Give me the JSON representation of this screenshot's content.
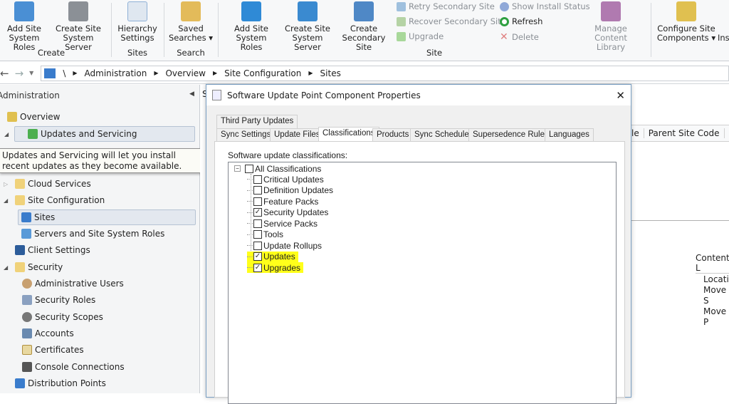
{
  "ribbon": {
    "buttons": [
      {
        "label1": "Add Site",
        "label2": "System Roles",
        "color": "#4a8fd4"
      },
      {
        "label1": "Create Site",
        "label2": "System Server",
        "color": "#8b9096"
      },
      {
        "label1": "Hierarchy",
        "label2": "Settings",
        "color": "#8fb0d6"
      },
      {
        "label1": "Saved",
        "label2": "Searches ▾",
        "color": "#e3bb5a"
      },
      {
        "label1": "Add Site",
        "label2": "System Roles",
        "color": "#2f8ad6"
      },
      {
        "label1": "Create Site",
        "label2": "System Server",
        "color": "#3a8ad0"
      },
      {
        "label1": "Create",
        "label2": "Secondary Site",
        "color": "#4f88c6"
      },
      {
        "label1": "Manage",
        "label2": "Content Library",
        "color": "#b07ab0"
      },
      {
        "label1": "Configure Site",
        "label2": "Components ▾",
        "color": "#e0c050"
      },
      {
        "label1": "Ins",
        "label2": ""
      }
    ],
    "small_buttons": [
      {
        "label": "Retry Secondary Site",
        "enabled": false
      },
      {
        "label": "Recover Secondary Site",
        "enabled": false
      },
      {
        "label": "Upgrade",
        "enabled": false
      },
      {
        "label": "Show Install Status",
        "enabled": false
      },
      {
        "label": "Refresh",
        "enabled": true
      },
      {
        "label": "Delete",
        "enabled": false
      }
    ],
    "groups": [
      "Create",
      "Sites",
      "Search",
      "Site"
    ]
  },
  "nav": {
    "breadcrumb": [
      "\\",
      "Administration",
      "Overview",
      "Site Configuration",
      "Sites"
    ]
  },
  "sidebar": {
    "title": "Administration",
    "items": [
      {
        "label": "Overview"
      },
      {
        "label": "Updates and Servicing"
      },
      {
        "label": "Cloud Services"
      },
      {
        "label": "Site Configuration"
      },
      {
        "label": "Sites"
      },
      {
        "label": "Servers and Site System Roles"
      },
      {
        "label": "Client Settings"
      },
      {
        "label": "Security"
      },
      {
        "label": "Administrative Users"
      },
      {
        "label": "Security Roles"
      },
      {
        "label": "Security Scopes"
      },
      {
        "label": "Accounts"
      },
      {
        "label": "Certificates"
      },
      {
        "label": "Console Connections"
      },
      {
        "label": "Distribution Points"
      }
    ],
    "tooltip": "Updates and Servicing will let you install recent updates as they become available."
  },
  "main": {
    "column_partial": "le",
    "column": "Parent Site Code",
    "section": "Content L",
    "details": [
      "Locatio",
      "Move S",
      "Move P"
    ],
    "pane_letter": "S"
  },
  "dialog": {
    "title": "Software Update Point Component Properties",
    "tabs_row1": [
      "Third Party Updates"
    ],
    "tabs_row2": [
      "Sync Settings",
      "Update Files",
      "Classifications",
      "Products",
      "Sync Schedule",
      "Supersedence Rules",
      "Languages"
    ],
    "active_tab": "Classifications",
    "label": "Software update classifications:",
    "root": {
      "label": "All Classifications",
      "checked": false
    },
    "classifications": [
      {
        "label": "Critical Updates",
        "checked": false
      },
      {
        "label": "Definition Updates",
        "checked": false
      },
      {
        "label": "Feature Packs",
        "checked": false
      },
      {
        "label": "Security Updates",
        "checked": true
      },
      {
        "label": "Service Packs",
        "checked": false
      },
      {
        "label": "Tools",
        "checked": false
      },
      {
        "label": "Update Rollups",
        "checked": false
      },
      {
        "label": "Updates",
        "checked": true,
        "highlighted": true
      },
      {
        "label": "Upgrades",
        "checked": true,
        "highlighted": true
      }
    ],
    "highlight_color": "#ffff1a"
  }
}
